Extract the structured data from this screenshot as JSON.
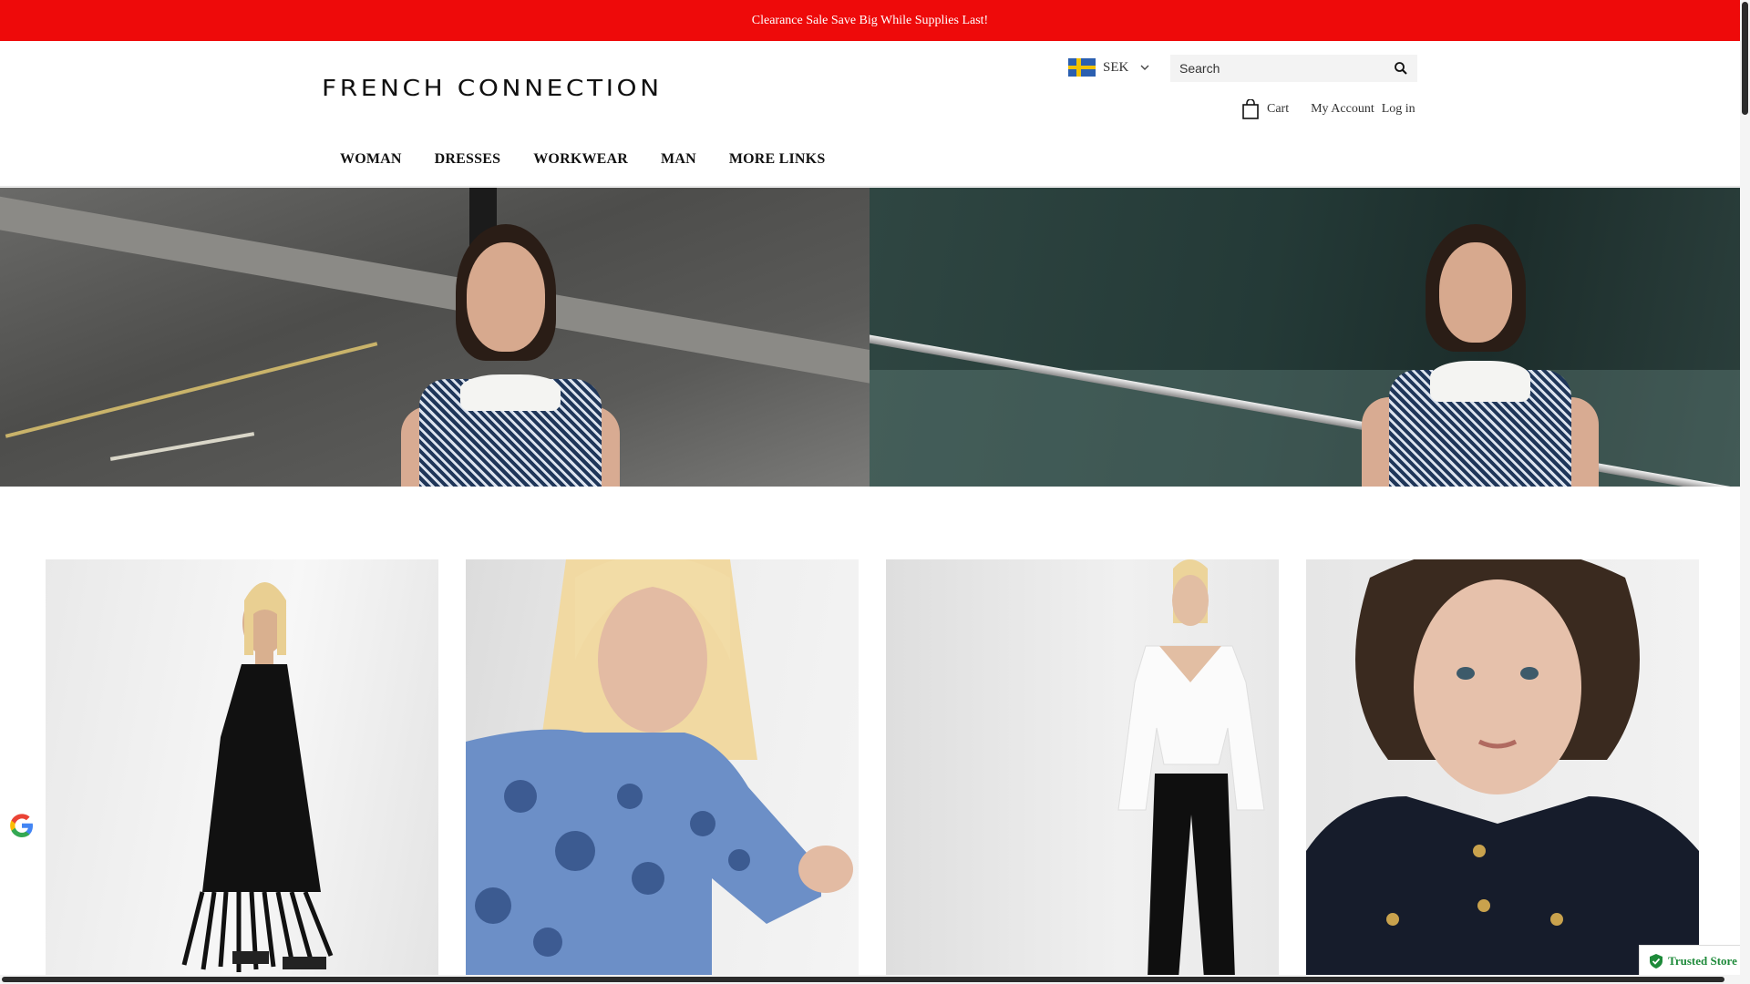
{
  "promo": {
    "text": "Clearance Sale Save Big While Supplies Last!"
  },
  "header": {
    "logo": "FRENCH CONNECTION",
    "currency": {
      "code": "SEK",
      "flag": "sweden-flag-icon"
    },
    "search": {
      "placeholder": "Search",
      "icon": "search-icon"
    },
    "cart_label": "Cart",
    "my_account_label": "My Account",
    "login_label": "Log in"
  },
  "nav": {
    "items": [
      {
        "label": "WOMAN"
      },
      {
        "label": "DRESSES"
      },
      {
        "label": "WORKWEAR"
      },
      {
        "label": "MAN"
      },
      {
        "label": "MORE LINKS"
      }
    ]
  },
  "products": [
    {
      "name": "black-fringe-dress"
    },
    {
      "name": "blue-floral-blouse"
    },
    {
      "name": "white-knit-sweater-black-trousers"
    },
    {
      "name": "navy-knit-vest"
    }
  ],
  "trusted_store": {
    "label": "Trusted Store",
    "icon": "shield-check-icon"
  },
  "colors": {
    "promo_bg": "#ee0a0a",
    "promo_text": "#ffffff",
    "trusted_green": "#1e8a3a"
  }
}
